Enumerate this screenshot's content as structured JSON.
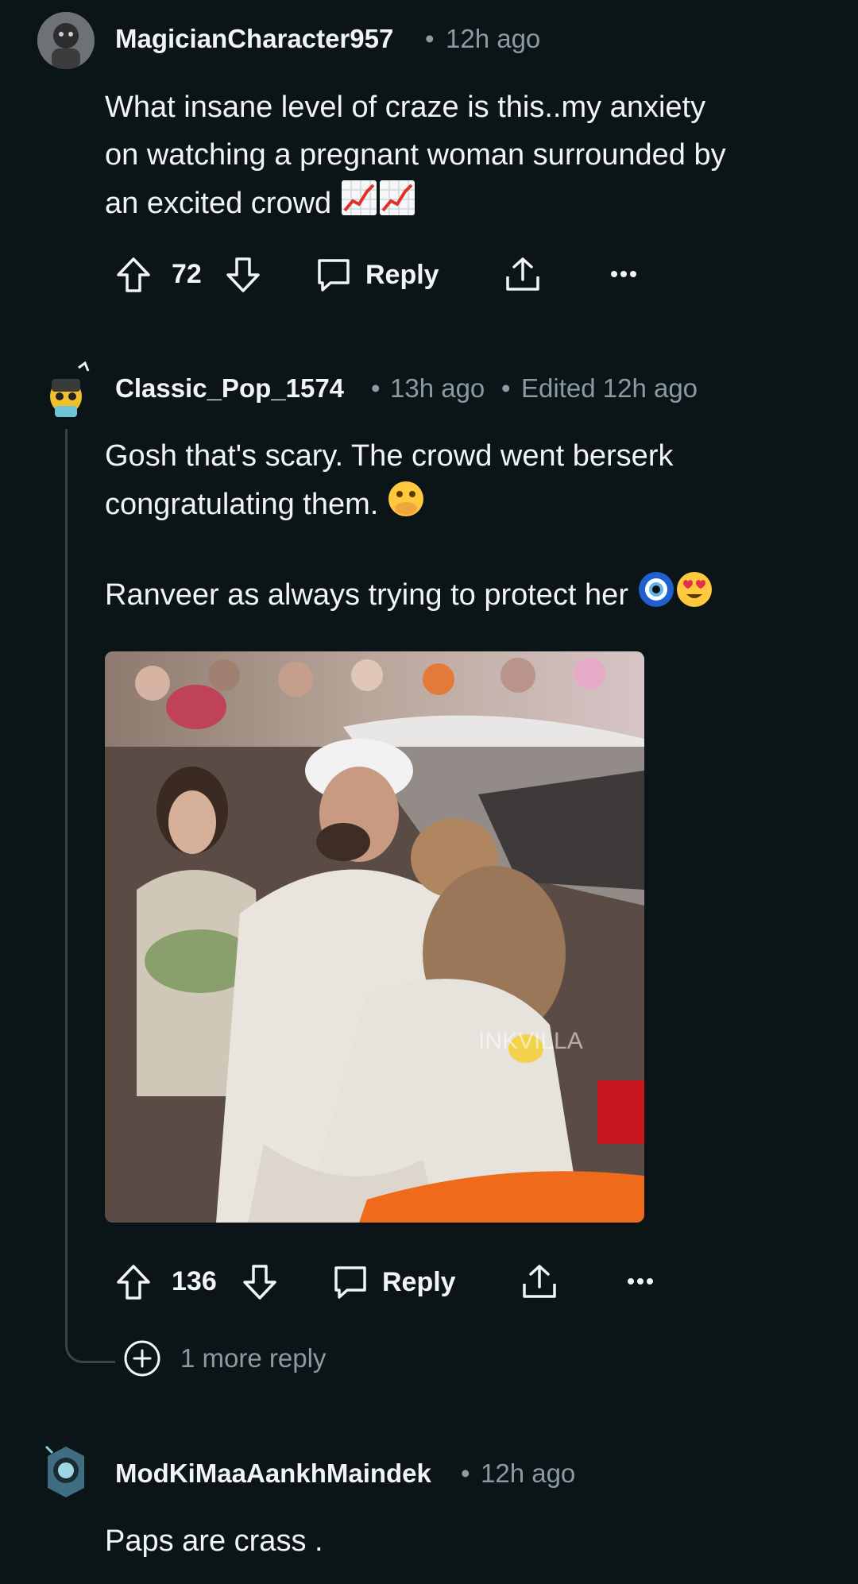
{
  "comments": [
    {
      "username": "MagicianCharacter957",
      "time": "12h ago",
      "body_lines": [
        "What insane level of craze is this..my anxiety",
        "on watching a pregnant woman surrounded by",
        "an excited crowd"
      ],
      "emoji_names": [
        "chart-increasing-emoji",
        "chart-increasing-emoji"
      ],
      "votes": "72",
      "reply_label": "Reply"
    },
    {
      "username": "Classic_Pop_1574",
      "time": "13h ago",
      "edited": "Edited 12h ago",
      "body_lines": [
        "Gosh that's scary. The crowd went berserk",
        "congratulating them."
      ],
      "body_line3": "Ranveer as always trying to protect her",
      "emoji_names": [
        "face-with-open-eyes-and-hand-over-mouth-emoji",
        "nazar-amulet-emoji",
        "heart-eyes-emoji"
      ],
      "image_watermark": "INKVILLA",
      "votes": "136",
      "reply_label": "Reply",
      "more_replies": "1 more reply"
    },
    {
      "username": "ModKiMaaAankhMaindek",
      "time": "12h ago",
      "body": "Paps are crass ."
    }
  ],
  "colors": {
    "background": "#0b1416",
    "text": "#f2f4f5",
    "meta": "#8b9ba3",
    "thread_line": "#3a4447"
  }
}
